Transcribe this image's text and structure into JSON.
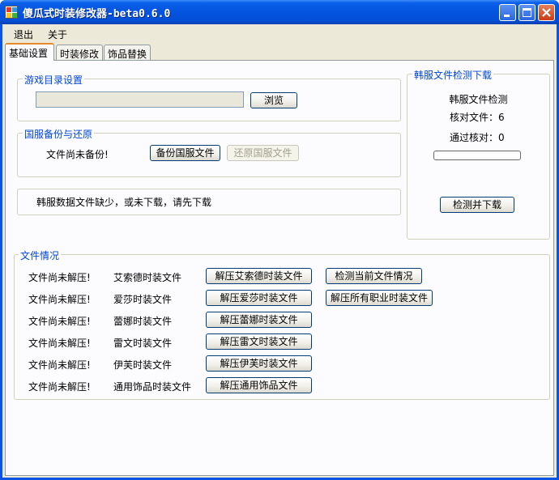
{
  "window": {
    "title": "傻瓜式时装修改器-beta0.6.0"
  },
  "menu": {
    "items": [
      "退出",
      "关于"
    ]
  },
  "tabs": [
    "基础设置",
    "时装修改",
    "饰品替换"
  ],
  "game_dir": {
    "label": "游戏目录设置",
    "path_value": "",
    "browse_label": "浏览"
  },
  "backup": {
    "label": "国服备份与还原",
    "status": "文件尚未备份!",
    "backup_button": "备份国服文件",
    "restore_button": "还原国服文件"
  },
  "status_message": "韩服数据文件缺少，或未下载，请先下载",
  "kr_check": {
    "label": "韩服文件检测下载",
    "title": "韩服文件检测",
    "check_files": "核对文件：6",
    "passed": "通过核对：0",
    "progress": 0,
    "button": "检测并下载"
  },
  "files": {
    "label": "文件情况",
    "rows": [
      {
        "status": "文件尚未解压!",
        "name": "艾索德时装文件",
        "button": "解压艾索德时装文件"
      },
      {
        "status": "文件尚未解压!",
        "name": "爱莎时装文件",
        "button": "解压爱莎时装文件"
      },
      {
        "status": "文件尚未解压!",
        "name": "蕾娜时装文件",
        "button": "解压蕾娜时装文件"
      },
      {
        "status": "文件尚未解压!",
        "name": "雷文时装文件",
        "button": "解压雷文时装文件"
      },
      {
        "status": "文件尚未解压!",
        "name": "伊芙时装文件",
        "button": "解压伊芙时装文件"
      },
      {
        "status": "文件尚未解压!",
        "name": "通用饰品时装文件",
        "button": "解压通用饰品文件"
      }
    ],
    "check_current": "检测当前文件情况",
    "extract_all": "解压所有职业时装文件"
  },
  "colors": {
    "group_label": "#0046d5",
    "titlebar": "#0454e0",
    "client_bg": "#ece9d8"
  },
  "icons": [
    "app-icon",
    "minimize-icon",
    "maximize-icon",
    "close-icon"
  ]
}
